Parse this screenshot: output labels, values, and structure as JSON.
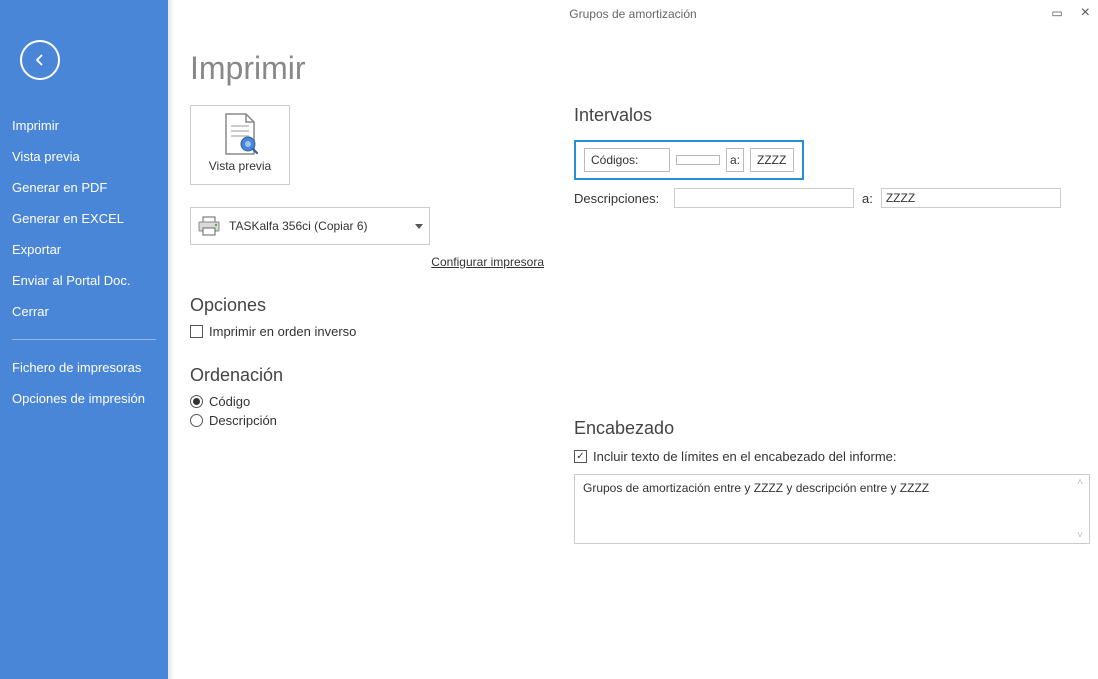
{
  "window": {
    "title": "Grupos de amortización"
  },
  "sidebar": {
    "items": [
      "Imprimir",
      "Vista previa",
      "Generar en PDF",
      "Generar en EXCEL",
      "Exportar",
      "Enviar al Portal Doc.",
      "Cerrar"
    ],
    "itemsSecondary": [
      "Fichero de impresoras",
      "Opciones de impresión"
    ]
  },
  "page": {
    "title": "Imprimir",
    "previewLabel": "Vista previa",
    "printerName": "TASKalfa 356ci (Copiar 6)",
    "configurePrinter": "Configurar impresora"
  },
  "options": {
    "heading": "Opciones",
    "reverseOrder": {
      "label": "Imprimir en orden inverso",
      "checked": false
    }
  },
  "ordering": {
    "heading": "Ordenación",
    "options": [
      {
        "label": "Código",
        "selected": true
      },
      {
        "label": "Descripción",
        "selected": false
      }
    ]
  },
  "intervals": {
    "heading": "Intervalos",
    "codes": {
      "label": "Códigos:",
      "from": "",
      "toLabel": "a:",
      "to": "ZZZZ"
    },
    "descriptions": {
      "label": "Descripciones:",
      "from": "",
      "toLabel": "a:",
      "to": "ZZZZ"
    }
  },
  "header": {
    "heading": "Encabezado",
    "includeLimits": {
      "label": "Incluir texto de límites en el encabezado del informe:",
      "checked": true
    },
    "text": "Grupos de amortización entre  y ZZZZ y descripción entre  y ZZZZ"
  }
}
